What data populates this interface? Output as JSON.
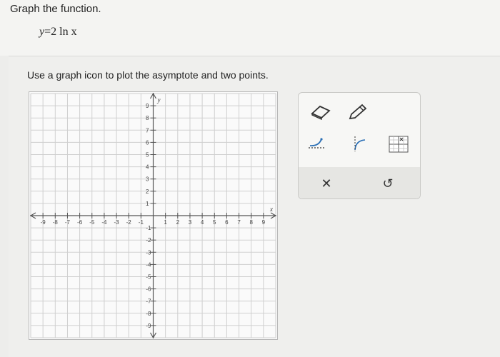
{
  "question": {
    "prompt": "Graph the function.",
    "equation_lhs": "y",
    "equation_rhs": "2 ln x"
  },
  "instruction": "Use a graph icon to plot the asymptote and two points.",
  "graph": {
    "x_axis_label": "x",
    "y_axis_label": "y",
    "x_range": [
      -10,
      10
    ],
    "y_range": [
      -10,
      10
    ],
    "x_tick_labels": [
      "-9",
      "-8",
      "-7",
      "-6",
      "-5",
      "-4",
      "-3",
      "-2",
      "-1",
      "1",
      "2",
      "3",
      "4",
      "5",
      "6",
      "7",
      "8",
      "9"
    ],
    "y_tick_labels_positive": [
      "1",
      "2",
      "3",
      "4",
      "5",
      "6",
      "7",
      "8",
      "9"
    ],
    "y_tick_labels_negative": [
      "-1",
      "-2",
      "-3",
      "-4",
      "-5",
      "-6",
      "-7",
      "-8",
      "-9"
    ],
    "grid": true,
    "colors": {
      "grid": "#cfcfcf",
      "axis": "#555555",
      "background": "#fafafa"
    }
  },
  "tools": [
    {
      "name": "eraser-tool",
      "icon": "eraser-icon"
    },
    {
      "name": "pencil-tool",
      "icon": "pencil-icon"
    },
    {
      "name": "asymptote-tool",
      "icon": "dashed-asymptote-icon"
    },
    {
      "name": "log-curve-tool",
      "icon": "log-curve-icon"
    },
    {
      "name": "graph-grid-tool",
      "icon": "grid-graph-icon"
    }
  ],
  "actions": [
    {
      "name": "clear-button",
      "icon": "close-icon",
      "glyph": "✕"
    },
    {
      "name": "undo-button",
      "icon": "undo-icon",
      "glyph": "↺"
    }
  ]
}
